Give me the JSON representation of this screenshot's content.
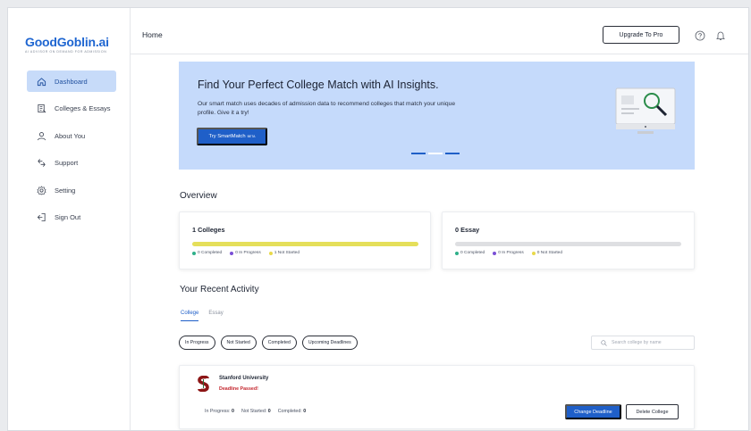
{
  "app": {
    "logo_title": "GoodGoblin.ai",
    "logo_subtitle": "AI ADVISOR ON DEMAND FOR ADMISSION"
  },
  "sidebar": {
    "items": [
      {
        "label": "Dashboard",
        "icon": "home-icon",
        "active": true
      },
      {
        "label": "Colleges & Essays",
        "icon": "document-icon",
        "active": false
      },
      {
        "label": "About You",
        "icon": "user-icon",
        "active": false
      },
      {
        "label": "Support",
        "icon": "support-icon",
        "active": false
      },
      {
        "label": "Setting",
        "icon": "gear-icon",
        "active": false
      },
      {
        "label": "Sign Out",
        "icon": "sign-out-icon",
        "active": false
      }
    ]
  },
  "header": {
    "title": "Home",
    "upgrade_label": "Upgrade To Pro",
    "help_icon": "help-circle-icon",
    "bell_icon": "bell-icon"
  },
  "banner": {
    "title": "Find Your Perfect College Match with AI Insights.",
    "text": "Our smart match uses decades of admission data to recommend colleges that match your unique profile. Give it a try!",
    "button_label": "Try SmartMatch",
    "button_badge": "BETA",
    "carousel_active_index": 0,
    "carousel_count": 3
  },
  "overview": {
    "title": "Overview",
    "colleges": {
      "title": "1 Colleges",
      "bar_color": "#e5df5a",
      "legend": [
        {
          "label": "0 Completed",
          "color": "#2fb08a"
        },
        {
          "label": "0 In Progress",
          "color": "#7a4fd6"
        },
        {
          "label": "1 Not Started",
          "color": "#e9d94a"
        }
      ]
    },
    "essays": {
      "title": "0 Essay",
      "bar_color": "#dedfe2",
      "legend": [
        {
          "label": "0 Completed",
          "color": "#2fb08a"
        },
        {
          "label": "0 In Progress",
          "color": "#7a4fd6"
        },
        {
          "label": "0 Not Started",
          "color": "#e9d94a"
        }
      ]
    }
  },
  "activity": {
    "title": "Your Recent Activity",
    "tabs": [
      {
        "label": "College",
        "active": true
      },
      {
        "label": "Essay",
        "active": false
      }
    ],
    "filters": [
      "In Progress",
      "Not Started",
      "Completed",
      "Upcoming Deadlines"
    ],
    "search_placeholder": "Search college by name",
    "college": {
      "name": "Stanford University",
      "status": "Deadline Passed!",
      "in_progress_label": "In Progress:",
      "in_progress_value": "0",
      "not_started_label": "Not Started:",
      "not_started_value": "0",
      "completed_label": "Completed:",
      "completed_value": "0",
      "change_deadline_label": "Change Deadline",
      "delete_label": "Delete College"
    }
  },
  "colors": {
    "accent": "#1f5fc8",
    "banner_bg": "#c5dafb",
    "nav_active_bg": "#c7dbf9",
    "danger": "#c4262e",
    "stanford_red": "#8c1515"
  }
}
